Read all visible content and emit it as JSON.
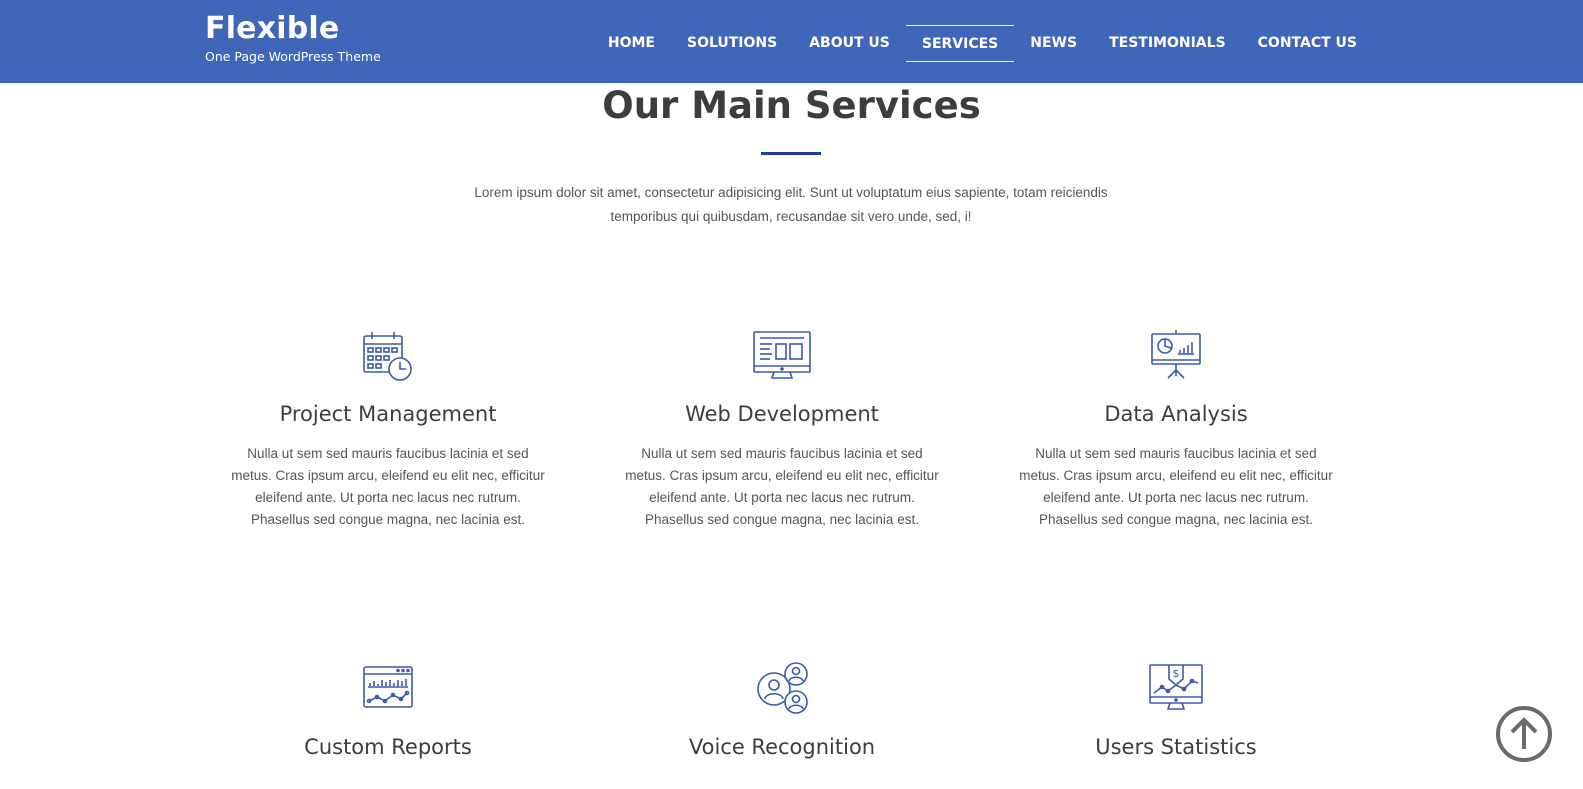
{
  "brand": {
    "title": "Flexible",
    "subtitle": "One Page WordPress Theme"
  },
  "nav": [
    {
      "label": "HOME"
    },
    {
      "label": "SOLUTIONS"
    },
    {
      "label": "ABOUT US"
    },
    {
      "label": "SERVICES",
      "active": true
    },
    {
      "label": "NEWS"
    },
    {
      "label": "TESTIMONIALS"
    },
    {
      "label": "CONTACT US"
    }
  ],
  "section": {
    "title": "Our Main Services",
    "intro": "Lorem ipsum dolor sit amet, consectetur adipisicing elit. Sunt ut voluptatum eius sapiente, totam reiciendis temporibus qui quibusdam, recusandae sit vero unde, sed, i!"
  },
  "services": [
    {
      "title": "Project Management",
      "icon": "calendar-clock-icon",
      "desc": "Nulla ut sem sed mauris faucibus lacinia et sed metus. Cras ipsum arcu, eleifend eu elit nec, efficitur eleifend ante. Ut porta nec lacus nec rutrum. Phasellus sed congue magna, nec lacinia est."
    },
    {
      "title": "Web Development",
      "icon": "monitor-layout-icon",
      "desc": "Nulla ut sem sed mauris faucibus lacinia et sed metus. Cras ipsum arcu, eleifend eu elit nec, efficitur eleifend ante. Ut porta nec lacus nec rutrum. Phasellus sed congue magna, nec lacinia est."
    },
    {
      "title": "Data Analysis",
      "icon": "presentation-board-icon",
      "desc": "Nulla ut sem sed mauris faucibus lacinia et sed metus. Cras ipsum arcu, eleifend eu elit nec, efficitur eleifend ante. Ut porta nec lacus nec rutrum. Phasellus sed congue magna, nec lacinia est."
    },
    {
      "title": "Custom Reports",
      "icon": "report-chart-icon"
    },
    {
      "title": "Voice Recognition",
      "icon": "users-group-icon"
    },
    {
      "title": "Users Statistics",
      "icon": "monitor-dollar-icon"
    }
  ],
  "colors": {
    "header": "#3f66b8",
    "accent": "#223f8e",
    "icon": "#3a5aa8"
  },
  "scroll_top": {
    "icon": "arrow-up-circle-icon"
  }
}
